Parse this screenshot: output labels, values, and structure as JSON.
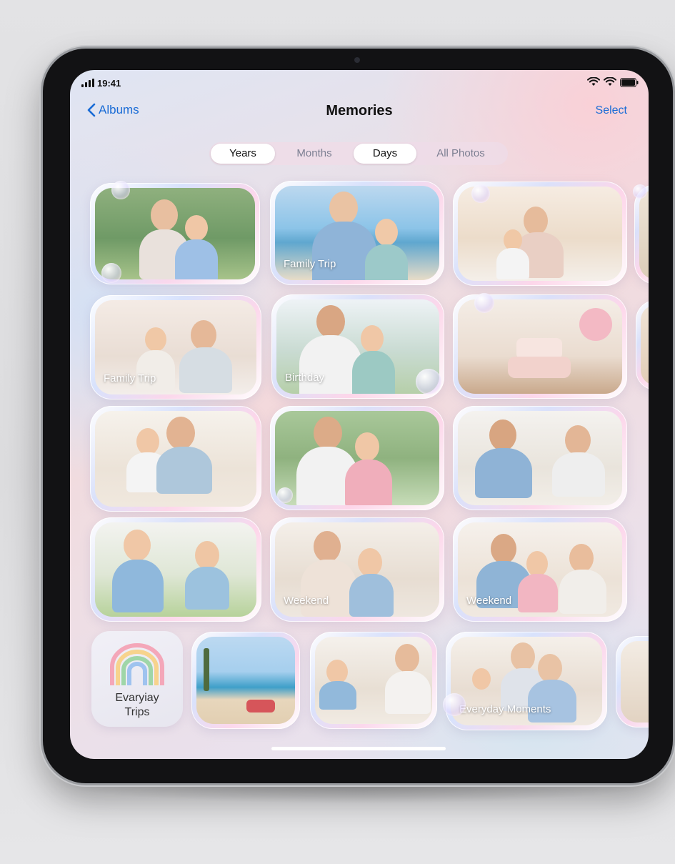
{
  "status_bar": {
    "time": "19:41"
  },
  "nav": {
    "back_label": "Albums",
    "title": "Memories",
    "select_label": "Select"
  },
  "segments": [
    {
      "label": "Years",
      "active": true
    },
    {
      "label": "Months",
      "active": false
    },
    {
      "label": "Days",
      "active": true
    },
    {
      "label": "All Photos",
      "active": false
    }
  ],
  "memories": [
    {
      "label": ""
    },
    {
      "label": "Family Trip"
    },
    {
      "label": ""
    },
    {
      "label": "Family Trip"
    },
    {
      "label": "Birthday"
    },
    {
      "label": ""
    },
    {
      "label": ""
    },
    {
      "label": ""
    },
    {
      "label": ""
    },
    {
      "label": ""
    },
    {
      "label": "Weekend"
    },
    {
      "label": "Weekend"
    },
    {
      "label": ""
    },
    {
      "label": ""
    },
    {
      "label": "Everyday Moments"
    }
  ],
  "album": {
    "line1": "Evaryiay",
    "line2": "Trips",
    "icon": "rainbow-arch-icon"
  },
  "colors": {
    "accent": "#1a6cd6",
    "text": "#111111",
    "segment_inactive": "#7c7f92"
  }
}
